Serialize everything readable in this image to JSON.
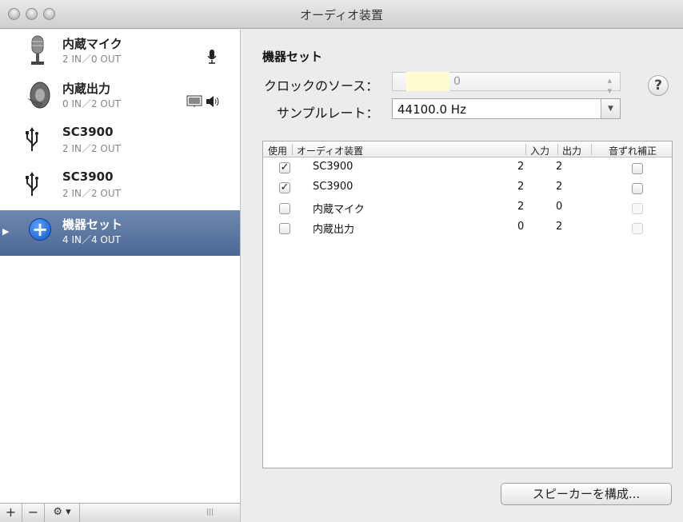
{
  "window": {
    "title": "オーディオ装置"
  },
  "sidebar": {
    "devices": [
      {
        "name": "内蔵マイク",
        "io": "2 IN／0 OUT",
        "icon": "microphone-icon",
        "extra": "🎙"
      },
      {
        "name": "内蔵出力",
        "io": "0 IN／2 OUT",
        "icon": "speaker-icon",
        "extra": "🖥 🔈"
      },
      {
        "name": "SC3900",
        "io": "2 IN／2 OUT",
        "icon": "usb-icon"
      },
      {
        "name": "SC3900",
        "io": "2 IN／2 OUT",
        "icon": "usb-icon"
      },
      {
        "name": "機器セット",
        "io": "4 IN／4 OUT",
        "icon": "aggregate-plus-icon",
        "selected": true
      }
    ],
    "footer": {
      "add": "+",
      "remove": "−",
      "gear": "⚙ ▾"
    }
  },
  "main": {
    "heading": "機器セット",
    "clock_label": "クロックのソース：",
    "clock_value": "0",
    "rate_label": "サンプルレート：",
    "rate_value": "44100.0 Hz",
    "help": "?",
    "table": {
      "headers": [
        "使用",
        "オーディオ装置",
        "入力",
        "出力",
        "音ずれ補正"
      ],
      "rows": [
        {
          "use": true,
          "device": "SC3900",
          "in": "2",
          "out": "2",
          "drift": false
        },
        {
          "use": true,
          "device": "SC3900",
          "in": "2",
          "out": "2",
          "drift": false
        },
        {
          "use": false,
          "device": "内蔵マイク",
          "in": "2",
          "out": "0",
          "drift": false
        },
        {
          "use": false,
          "device": "内蔵出力",
          "in": "0",
          "out": "2",
          "drift": false
        }
      ]
    },
    "configure_button": "スピーカーを構成..."
  }
}
